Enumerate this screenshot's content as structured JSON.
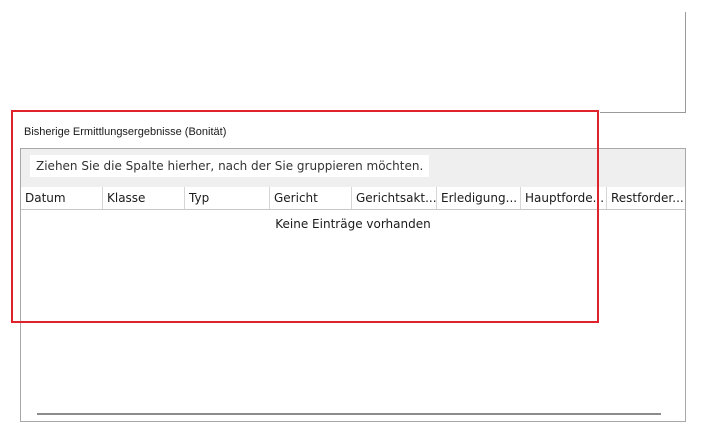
{
  "section": {
    "title": "Bisherige Ermittlungsergebnisse (Bonität)"
  },
  "grid": {
    "group_hint": "Ziehen Sie die Spalte hierher, nach der Sie gruppieren möchten.",
    "columns": [
      "Datum",
      "Klasse",
      "Typ",
      "Gericht",
      "Gerichtsakt...",
      "Erledigung...",
      "Hauptforde...",
      "Restforder..."
    ],
    "empty_text": "Keine Einträge vorhanden"
  },
  "colors": {
    "highlight": "#e0222a",
    "group_panel_bg": "#efefef",
    "border": "#a8a8a8"
  }
}
